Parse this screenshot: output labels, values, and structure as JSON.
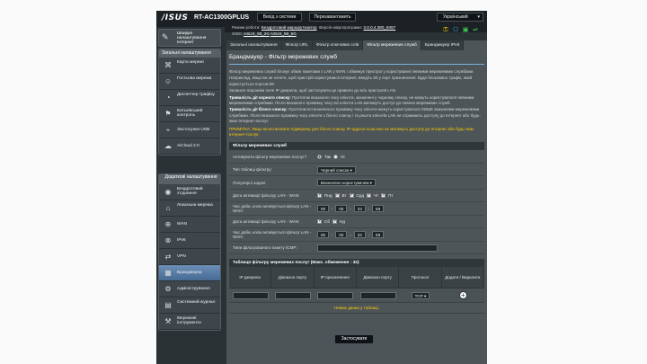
{
  "header": {
    "logo": "/ISUS",
    "model": "RT-AC1300GPLUS",
    "logout_label": "Вихід з системи",
    "reboot_label": "Перезавантажить",
    "language": "Український",
    "mode_label": "Режим роботи:",
    "mode_value": "Бездротовий маршрутизатор",
    "firmware_label": "Версія мікропрограми:",
    "firmware_value": "3.0.0.4.380_8457",
    "ssid_label": "SSID:",
    "ssid_24": "ASUS_58_2G",
    "ssid_5": "ASUS_58_5G"
  },
  "sidebar": {
    "quick": "Швидке налаштування Інтернет",
    "general_header": "Загальні налаштування",
    "general_items": [
      {
        "icon": "map-icon",
        "label": "Карта мережі"
      },
      {
        "icon": "guest-network-icon",
        "label": "Гостьова мережа"
      },
      {
        "icon": "traffic-manager-icon",
        "label": "Диспетчер трафіку"
      },
      {
        "icon": "parental-control-icon",
        "label": "Батьківський контроль"
      },
      {
        "icon": "usb-icon",
        "label": "Застосунки USB"
      },
      {
        "icon": "cloud-icon",
        "label": "AiCloud 2.0"
      }
    ],
    "advanced_header": "Додаткові налаштування",
    "advanced_items": [
      {
        "icon": "wireless-icon",
        "label": "Бездротовий з'єднання"
      },
      {
        "icon": "lan-icon",
        "label": "Локальна мережа"
      },
      {
        "icon": "wan-icon",
        "label": "WAN"
      },
      {
        "icon": "ipv6-icon",
        "label": "IPv6"
      },
      {
        "icon": "vpn-icon",
        "label": "VPN"
      },
      {
        "icon": "firewall-icon",
        "label": "Брандмауер"
      },
      {
        "icon": "administration-icon",
        "label": "Адміністрування"
      },
      {
        "icon": "system-log-icon",
        "label": "Системний журнал"
      },
      {
        "icon": "network-tools-icon",
        "label": "Мережеві інструменти"
      }
    ]
  },
  "tabs": [
    "Загальні налаштування",
    "Фільтр URL",
    "Фільтр ключових слів",
    "Фільтр мережевих служб",
    "Брандмауер IPv6"
  ],
  "page": {
    "title": "Брандмауер - Фільтр мережевих служб",
    "p1": "Фільтр мережевих служб блокує обмін пакетами з LAN у WAN і обмежує пристрої у користуванні певними мережевими службами.",
    "p2": "Наприклад, якщо ви не хочете, щоб пристрій користувався Інтернет, введіть 80 у порт призначення. Буде блоковано трафік, який користується портом 80.",
    "p3": "Залиште порожнім поле IP джерела, щоб застосувати це правило до всіх пристроїв LAN.",
    "blacklist_term": "Тривалість дії чорного списку:",
    "blacklist_text": "Протягом вказаного часу клієнти, зазначені у чорному списку, не можуть користуватися певними мережевими службами. Після вказаного проміжку часу всі клієнти LAN матимуть доступ до певних мережевих служб.",
    "whitelist_term": "Тривалість дії білого списку:",
    "whitelist_text": "Протягом встановленого проміжку часу клієнти можуть користуватися ЛИШЕ вказаними мережевими службами. Після вказаного проміжку часу клієнти з білого списку і та решта клієнтів LAN не отримають доступу до Інтернет або будь-яких Інтернет-послуг.",
    "note": "ПРИМІТКА: Якщо ви встановите підмережу для білого списку, IP-адреси поза нею не матимуть доступу до Інтернет або будь-яких Інтернет-послуг."
  },
  "filter": {
    "section_title": "Фільтр мережевих служб",
    "enable_label": "Активувати фільтр мережевих послуг?",
    "yes": "Так",
    "no": "Ні",
    "table_type_label": "Тип таблиці фільтру:",
    "table_type_value": "Чорний список",
    "well_known_label": "Популярні задачі:",
    "well_known_value": "Визначено користувачем",
    "date_label": "Дата активації фільтру LAN - WAN:",
    "days_week": [
      "Пнд",
      "Вт",
      "Срд",
      "Чт",
      "Пт"
    ],
    "time_label": "Час доби, коли активується фільтр LAN - WAN:",
    "time_week": [
      "00",
      "00",
      "23",
      "59"
    ],
    "date_label2": "Дата активації фільтру LAN - WAN:",
    "days_weekend": [
      "Сб",
      "Нд"
    ],
    "time_label2": "Час доби, коли активується фільтр LAN - WAN:",
    "time_weekend": [
      "00",
      "00",
      "23",
      "59"
    ],
    "icmp_label": "Типи фільтрованого пакету ICMP:"
  },
  "list": {
    "title": "Таблиця фільтру мережевих послуг (Макс. обмеження : 32)",
    "headers": [
      "IP джерела",
      "Діапазон порту",
      "IP призначення",
      "Діапазон порту",
      "Протокол",
      "Додати / Видалити"
    ],
    "protocol_value": "TCP",
    "empty_text": "Немає даних у таблиці.",
    "apply_label": "Застосувати"
  }
}
